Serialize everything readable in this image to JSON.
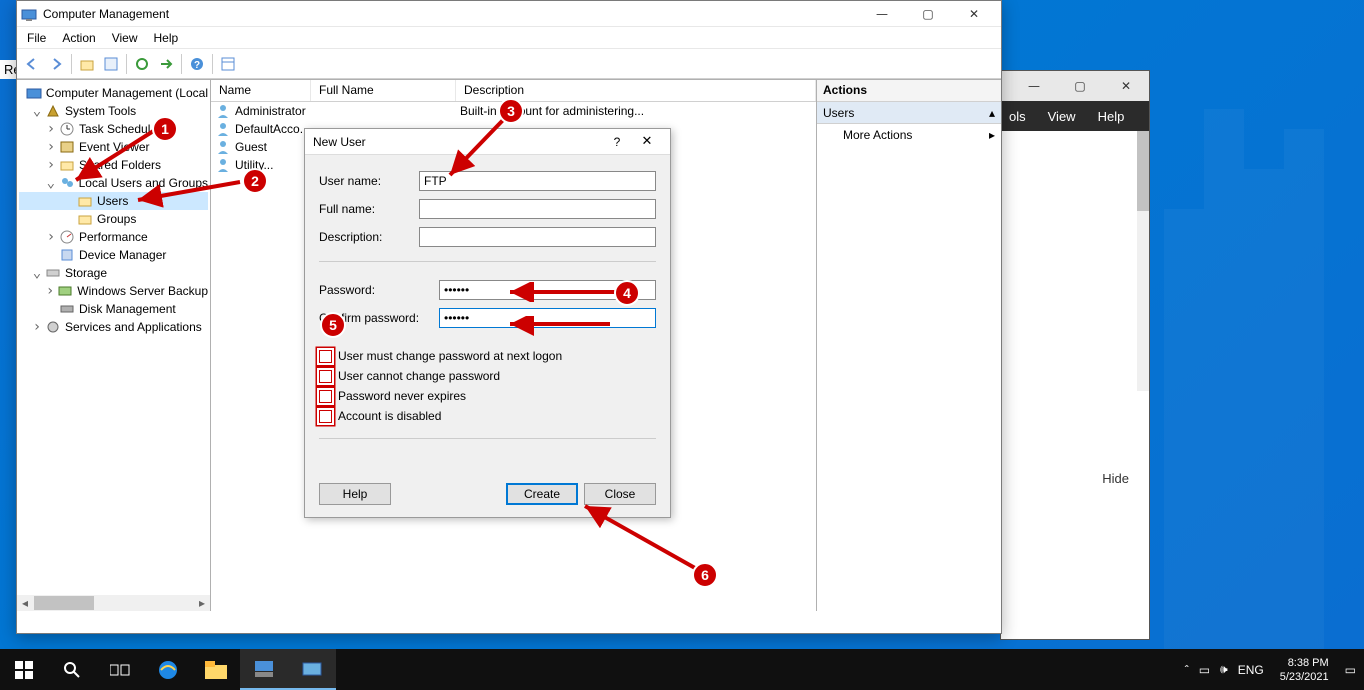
{
  "background_cut_text": "Re",
  "bg_window": {
    "menu": [
      "ols",
      "View",
      "Help"
    ],
    "hide": "Hide"
  },
  "mmc": {
    "title": "Computer Management",
    "menu": [
      "File",
      "Action",
      "View",
      "Help"
    ],
    "tree": {
      "root": "Computer Management (Local",
      "system_tools": "System Tools",
      "task_scheduler": "Task Schedul",
      "event_viewer": "Event Viewer",
      "shared_folders": "Shared Folders",
      "local_users": "Local Users and Groups",
      "users": "Users",
      "groups": "Groups",
      "performance": "Performance",
      "device_manager": "Device Manager",
      "storage": "Storage",
      "wsb": "Windows Server Backup",
      "disk_mgmt": "Disk Management",
      "services_apps": "Services and Applications"
    },
    "list": {
      "col_name": "Name",
      "col_full": "Full Name",
      "col_desc": "Description",
      "rows": [
        {
          "name": "Administrator",
          "full": "",
          "desc": "Built-in account for administering..."
        },
        {
          "name": "DefaultAcco...",
          "full": "",
          "desc": ""
        },
        {
          "name": "Guest",
          "full": "",
          "desc": ""
        },
        {
          "name": "        Utility...",
          "full": "",
          "desc": ""
        }
      ]
    },
    "actions": {
      "hdr": "Actions",
      "sub": "Users",
      "more": "More Actions"
    }
  },
  "dialog": {
    "title": "New User",
    "labels": {
      "user": "User name:",
      "full": "Full name:",
      "desc": "Description:",
      "pwd": "Password:",
      "cpwd": "Confirm password:"
    },
    "values": {
      "user": "FTP",
      "full": "",
      "desc": "",
      "pwd": "••••••",
      "cpwd": "••••••"
    },
    "checks": {
      "must_change": "User must change password at next logon",
      "cannot_change": "User cannot change password",
      "never_exp": "Password never expires",
      "disabled": "Account is disabled"
    },
    "buttons": {
      "help": "Help",
      "create": "Create",
      "close": "Close"
    }
  },
  "callouts": {
    "c1": "1",
    "c2": "2",
    "c3": "3",
    "c4": "4",
    "c5": "5",
    "c6": "6"
  },
  "taskbar": {
    "lang": "ENG",
    "time": "8:38 PM",
    "date": "5/23/2021"
  }
}
